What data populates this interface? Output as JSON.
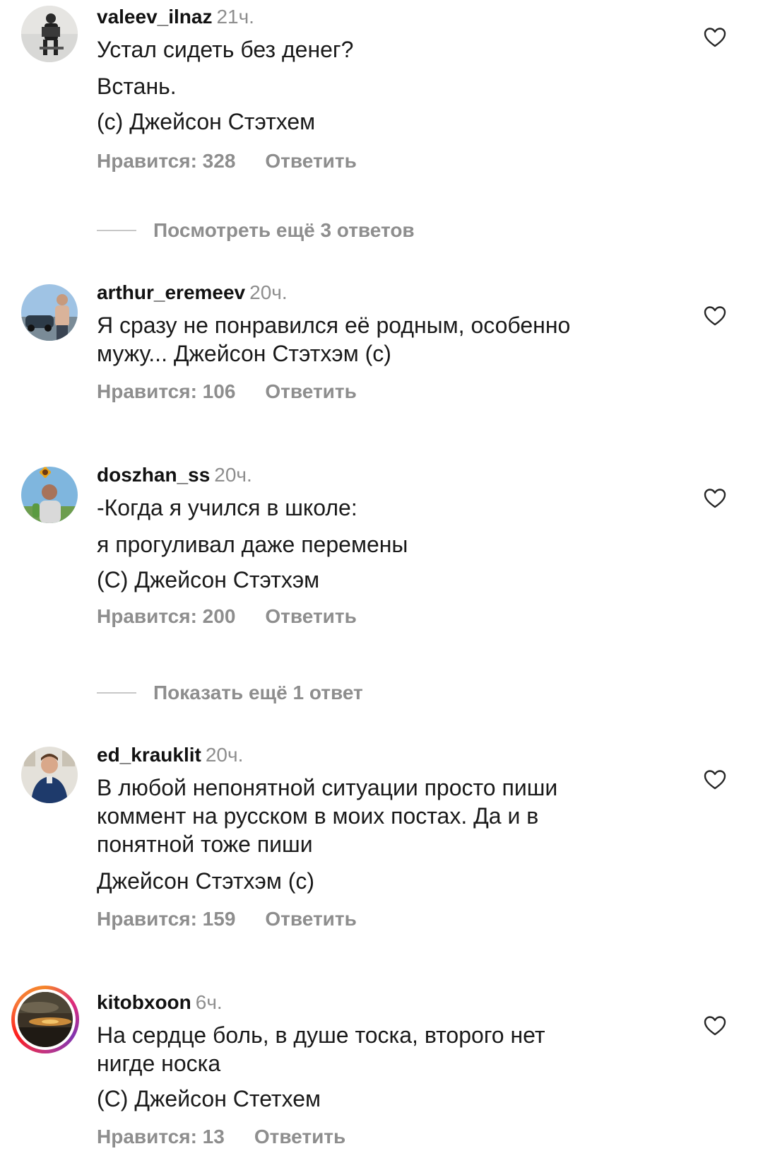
{
  "comments": [
    {
      "username": "valeev_ilnaz",
      "time": "21ч.",
      "lines": [
        "Устал сидеть без денег?",
        "Встань.",
        "(с) Джейсон Стэтхем"
      ],
      "likes_label": "Нравится: 328",
      "reply_label": "Ответить",
      "avatar_icon": "person-with-accordion-photo",
      "has_story_ring": false
    },
    {
      "username": "arthur_eremeev",
      "time": "20ч.",
      "lines": [
        "Я сразу не понравился её родным, особенно",
        "мужу... Джейсон Стэтхэм (с)"
      ],
      "likes_label": "Нравится: 106",
      "reply_label": "Ответить",
      "avatar_icon": "man-by-car-photo",
      "has_story_ring": false
    },
    {
      "username": "doszhan_ss",
      "time": "20ч.",
      "lines": [
        "-Когда я учился в школе:",
        "я прогуливал даже перемены",
        "(С) Джейсон Стэтхэм"
      ],
      "likes_label": "Нравится: 200",
      "reply_label": "Ответить",
      "avatar_icon": "man-with-sunflower-photo",
      "has_story_ring": false
    },
    {
      "username": "ed_krauklit",
      "time": "20ч.",
      "lines": [
        "В любой непонятной ситуации просто пиши",
        "коммент на русском в моих постах. Да и в",
        "понятной тоже пиши",
        "Джейсон Стэтхэм (с)"
      ],
      "likes_label": "Нравится: 159",
      "reply_label": "Ответить",
      "avatar_icon": "man-in-shirt-photo",
      "has_story_ring": false
    },
    {
      "username": "kitobxoon",
      "time": "6ч.",
      "lines": [
        "На сердце боль, в душе тоска, второго нет",
        "нигде носка",
        "(С) Джейсон Стетхем"
      ],
      "likes_label": "Нравится: 13",
      "reply_label": "Ответить",
      "avatar_icon": "sunset-clouds-photo",
      "has_story_ring": true
    }
  ],
  "reply_toggles": [
    {
      "label": "Посмотреть ещё 3 ответов"
    },
    {
      "label": "Показать ещё 1 ответ"
    }
  ],
  "colors": {
    "text": "#1a1a1a",
    "muted": "#8e8e8e",
    "rule": "#c7c7c7",
    "story_ring": "#dd2a7b"
  }
}
